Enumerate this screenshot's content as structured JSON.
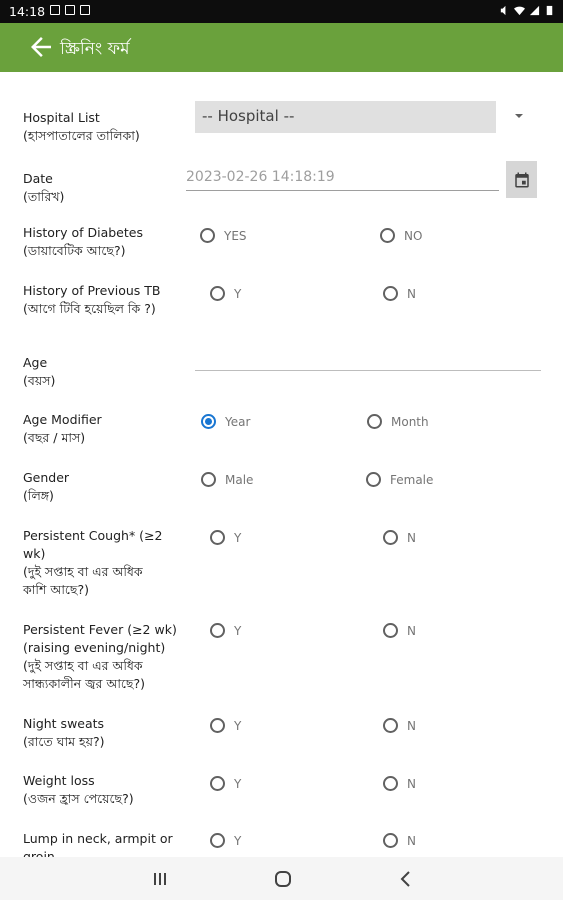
{
  "status_bar": {
    "time": "14:18"
  },
  "app_bar": {
    "title": "স্ক্রিনিং ফর্ম"
  },
  "form": {
    "hospital": {
      "label": "Hospital List",
      "label_bn": "(হাসপাতালের তালিকা)",
      "value": "-- Hospital --"
    },
    "date": {
      "label": "Date",
      "label_bn": "(তারিখ)",
      "value": "2023-02-26 14:18:19"
    },
    "diabetes": {
      "label": "History of Diabetes",
      "label_bn": "(ডায়াবেটিক আছে?)",
      "opt1": "YES",
      "opt2": "NO"
    },
    "prev_tb": {
      "label": "History of Previous TB",
      "label_bn": "(আগে টিবি হয়েছিল কি ?)",
      "opt1": "Y",
      "opt2": "N"
    },
    "age": {
      "label": "Age",
      "label_bn": "(বয়স)"
    },
    "age_modifier": {
      "label": "Age Modifier",
      "label_bn": "(বছর / মাস)",
      "opt1": "Year",
      "opt2": "Month",
      "selected": "Year"
    },
    "gender": {
      "label": "Gender",
      "label_bn": "(লিঙ্গ)",
      "opt1": "Male",
      "opt2": "Female"
    },
    "cough": {
      "label1": "Persistent Cough* (≥2",
      "label2": "wk)",
      "label_bn1": "(দুই সপ্তাহ বা এর অধিক",
      "label_bn2": "কাশি আছে?)",
      "opt1": "Y",
      "opt2": "N"
    },
    "fever": {
      "label1": "Persistent Fever (≥2 wk)",
      "label2": "(raising evening/night)",
      "label_bn1": "(দুই সপ্তাহ বা এর অধিক",
      "label_bn2": "সান্ধ্যকালীন জ্বর আছে?)",
      "opt1": "Y",
      "opt2": "N"
    },
    "night_sweats": {
      "label": "Night sweats",
      "label_bn": "(রাতে ঘাম হয়?)",
      "opt1": "Y",
      "opt2": "N"
    },
    "weight_loss": {
      "label": "Weight loss",
      "label_bn": "(ওজন হ্রাস পেয়েছে?)",
      "opt1": "Y",
      "opt2": "N"
    },
    "lump": {
      "label1": "Lump in  neck, armpit or",
      "label2": "groin",
      "opt1": "Y",
      "opt2": "N"
    }
  }
}
